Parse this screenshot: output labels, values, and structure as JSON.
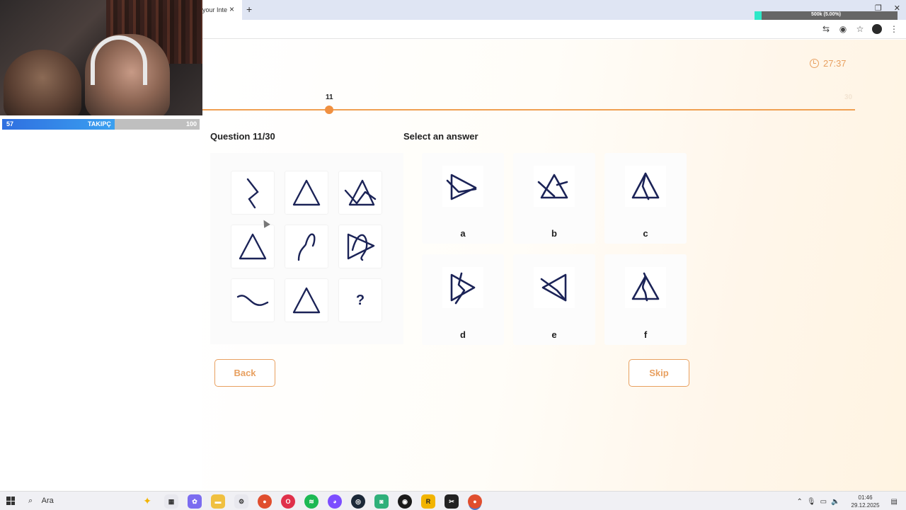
{
  "overlay": {
    "follow_bar": {
      "current": "57",
      "label": "TAKIPÇ",
      "max": "100",
      "fraction": 0.57
    },
    "progress": {
      "text": "500k (5.00%)",
      "fraction": 0.05
    }
  },
  "browser": {
    "tab_title": "your Inte",
    "close_tab": "×",
    "new_tab": "+"
  },
  "quiz": {
    "timer": "27:37",
    "current_question_number": "11",
    "total_questions": "30",
    "progress_fraction": 0.36,
    "question_label": "Question 11/30",
    "answer_heading": "Select an answer",
    "puzzle_cells": [
      "zigzag",
      "triangle",
      "crossed-triangle",
      "triangle",
      "s-curve",
      "tangled-triangle",
      "wave",
      "triangle",
      "?"
    ],
    "answers": [
      {
        "label": "a",
        "glyph": "pointed-triangle"
      },
      {
        "label": "b",
        "glyph": "slashed-triangle"
      },
      {
        "label": "c",
        "glyph": "split-triangle"
      },
      {
        "label": "d",
        "glyph": "bent-triangle"
      },
      {
        "label": "e",
        "glyph": "left-triangle"
      },
      {
        "label": "f",
        "glyph": "curl-triangle"
      }
    ],
    "back_label": "Back",
    "skip_label": "Skip"
  },
  "taskbar": {
    "search_placeholder": "Ara",
    "time": "01:46",
    "date": "29.12.2025"
  },
  "colors": {
    "accent": "#e8a060",
    "glyph": "#1b2357",
    "track": "#f0a052"
  }
}
